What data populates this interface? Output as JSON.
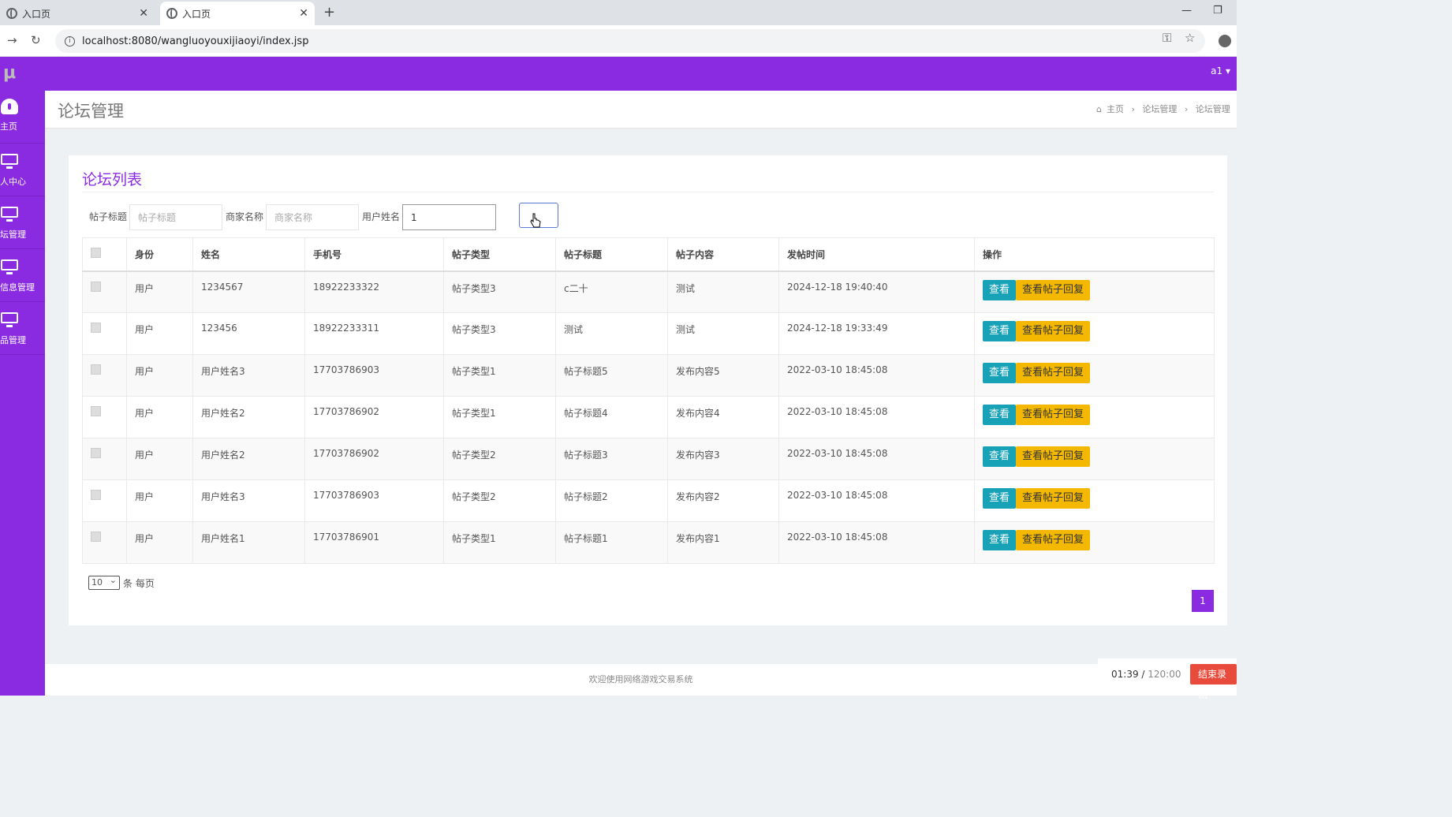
{
  "browser": {
    "tabs": [
      {
        "title": "入口页"
      },
      {
        "title": "入口页"
      }
    ],
    "url": "localhost:8080/wangluoyouxijiaoyi/index.jsp"
  },
  "topnav": {
    "logo": "μ",
    "user": "a1"
  },
  "sidebar": {
    "items": [
      {
        "label": "主页",
        "icon": "dashboard-icon"
      },
      {
        "label": "人中心",
        "icon": "monitor-icon"
      },
      {
        "label": "坛管理",
        "icon": "monitor-icon"
      },
      {
        "label": "信息管理",
        "icon": "monitor-icon"
      },
      {
        "label": "品管理",
        "icon": "monitor-icon"
      }
    ]
  },
  "page": {
    "title": "论坛管理",
    "breadcrumb": [
      "主页",
      "论坛管理",
      "论坛管理"
    ]
  },
  "card": {
    "title": "论坛列表",
    "filters": {
      "post_title_label": "帖子标题",
      "post_title_placeholder": "帖子标题",
      "merchant_label": "商家名称",
      "merchant_placeholder": "商家名称",
      "username_label": "用户姓名",
      "username_value": "1"
    },
    "table": {
      "headers": [
        "身份",
        "姓名",
        "手机号",
        "帖子类型",
        "帖子标题",
        "帖子内容",
        "发帖时间",
        "操作"
      ],
      "rows": [
        [
          "用户",
          "1234567",
          "18922233322",
          "帖子类型3",
          "c二十",
          "测试",
          "2024-12-18 19:40:40"
        ],
        [
          "用户",
          "123456",
          "18922233311",
          "帖子类型3",
          "测试",
          "测试",
          "2024-12-18 19:33:49"
        ],
        [
          "用户",
          "用户姓名3",
          "17703786903",
          "帖子类型1",
          "帖子标题5",
          "发布内容5",
          "2022-03-10 18:45:08"
        ],
        [
          "用户",
          "用户姓名2",
          "17703786902",
          "帖子类型1",
          "帖子标题4",
          "发布内容4",
          "2022-03-10 18:45:08"
        ],
        [
          "用户",
          "用户姓名2",
          "17703786902",
          "帖子类型2",
          "帖子标题3",
          "发布内容3",
          "2022-03-10 18:45:08"
        ],
        [
          "用户",
          "用户姓名3",
          "17703786903",
          "帖子类型2",
          "帖子标题2",
          "发布内容2",
          "2022-03-10 18:45:08"
        ],
        [
          "用户",
          "用户姓名1",
          "17703786901",
          "帖子类型1",
          "帖子标题1",
          "发布内容1",
          "2022-03-10 18:45:08"
        ]
      ],
      "view_label": "查看",
      "reply_label": "查看帖子回复"
    },
    "pagination": {
      "page_size": "10",
      "page_size_suffix": "条 每页",
      "current_page": "1"
    }
  },
  "footer": {
    "text": "欢迎使用网络游戏交易系统"
  },
  "recorder": {
    "elapsed": "01:39",
    "separator": " / ",
    "total": "120:00",
    "stop_label": "结束录制"
  },
  "colors": {
    "primary": "#8a2be2",
    "view_button": "#17a2b8",
    "reply_button": "#f5b800",
    "stop_button": "#e84a3b"
  }
}
